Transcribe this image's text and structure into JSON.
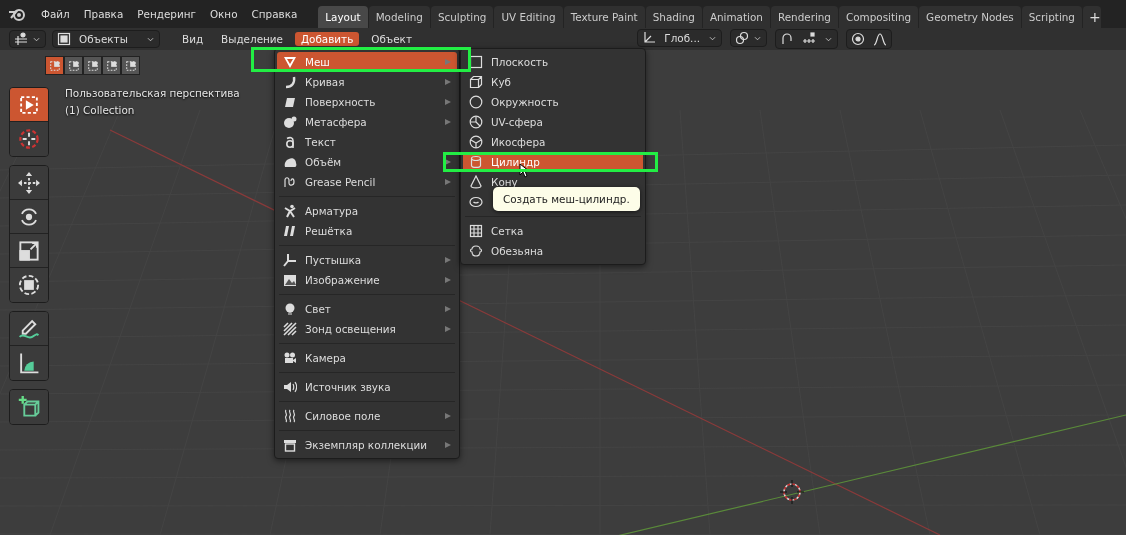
{
  "top_bar": {
    "menus": [
      "Файл",
      "Правка",
      "Рендеринг",
      "Окно",
      "Справка"
    ],
    "workspace_tabs": [
      {
        "label": "Layout",
        "selected": true
      },
      {
        "label": "Modeling",
        "selected": false
      },
      {
        "label": "Sculpting",
        "selected": false
      },
      {
        "label": "UV Editing",
        "selected": false
      },
      {
        "label": "Texture Paint",
        "selected": false
      },
      {
        "label": "Shading",
        "selected": false
      },
      {
        "label": "Animation",
        "selected": false
      },
      {
        "label": "Rendering",
        "selected": false
      },
      {
        "label": "Compositing",
        "selected": false
      },
      {
        "label": "Geometry Nodes",
        "selected": false
      },
      {
        "label": "Scripting",
        "selected": false
      }
    ],
    "add_tab_button": "+"
  },
  "header": {
    "mode_dropdown": "Объекты",
    "menus": [
      {
        "label": "Вид",
        "selected": false
      },
      {
        "label": "Выделение",
        "selected": false
      },
      {
        "label": "Добавить",
        "selected": true
      },
      {
        "label": "Объект",
        "selected": false
      }
    ],
    "orientation_dropdown": "Глоб..."
  },
  "toolbar": {
    "select_modes": [
      {
        "selected": true
      },
      {
        "selected": false
      },
      {
        "selected": false
      },
      {
        "selected": false
      },
      {
        "selected": false
      }
    ],
    "tools": [
      {
        "selected": true
      },
      {
        "selected": false
      },
      {
        "selected": false
      },
      {
        "selected": false
      },
      {
        "selected": false
      },
      {
        "selected": false
      },
      {
        "selected": false
      },
      {
        "selected": false
      },
      {
        "selected": false
      }
    ]
  },
  "viewport": {
    "view_name": "Пользовательская перспектива",
    "collection": "(1) Collection"
  },
  "add_menu": {
    "items": [
      {
        "kind": "item",
        "label": "Меш",
        "has_submenu": true,
        "selected": true
      },
      {
        "kind": "item",
        "label": "Кривая",
        "has_submenu": true,
        "selected": false
      },
      {
        "kind": "item",
        "label": "Поверхность",
        "has_submenu": true,
        "selected": false
      },
      {
        "kind": "item",
        "label": "Метасфера",
        "has_submenu": true,
        "selected": false
      },
      {
        "kind": "item",
        "label": "Текст",
        "has_submenu": false,
        "selected": false
      },
      {
        "kind": "item",
        "label": "Объём",
        "has_submenu": true,
        "selected": false
      },
      {
        "kind": "item",
        "label": "Grease Pencil",
        "has_submenu": true,
        "selected": false
      },
      {
        "kind": "separator"
      },
      {
        "kind": "item",
        "label": "Арматура",
        "has_submenu": false,
        "selected": false
      },
      {
        "kind": "item",
        "label": "Решётка",
        "has_submenu": false,
        "selected": false
      },
      {
        "kind": "separator"
      },
      {
        "kind": "item",
        "label": "Пустышка",
        "has_submenu": true,
        "selected": false
      },
      {
        "kind": "item",
        "label": "Изображение",
        "has_submenu": true,
        "selected": false
      },
      {
        "kind": "separator"
      },
      {
        "kind": "item",
        "label": "Свет",
        "has_submenu": true,
        "selected": false
      },
      {
        "kind": "item",
        "label": "Зонд освещения",
        "has_submenu": true,
        "selected": false
      },
      {
        "kind": "separator"
      },
      {
        "kind": "item",
        "label": "Камера",
        "has_submenu": false,
        "selected": false
      },
      {
        "kind": "separator"
      },
      {
        "kind": "item",
        "label": "Источник звука",
        "has_submenu": false,
        "selected": false
      },
      {
        "kind": "separator"
      },
      {
        "kind": "item",
        "label": "Силовое поле",
        "has_submenu": true,
        "selected": false
      },
      {
        "kind": "separator"
      },
      {
        "kind": "item",
        "label": "Экземпляр коллекции",
        "has_submenu": true,
        "selected": false
      }
    ]
  },
  "mesh_menu": {
    "items": [
      {
        "kind": "item",
        "label": "Плоскость",
        "selected": false
      },
      {
        "kind": "item",
        "label": "Куб",
        "selected": false
      },
      {
        "kind": "item",
        "label": "Окружность",
        "selected": false
      },
      {
        "kind": "item",
        "label": "UV-сфера",
        "selected": false
      },
      {
        "kind": "item",
        "label": "Икосфера",
        "selected": false
      },
      {
        "kind": "item",
        "label": "Цилиндр",
        "selected": true
      },
      {
        "kind": "item",
        "label": "Кону",
        "selected": false
      },
      {
        "kind": "item",
        "selected": false
      },
      {
        "kind": "separator"
      },
      {
        "kind": "item",
        "label": "Сетка",
        "selected": false
      },
      {
        "kind": "item",
        "label": "Обезьяна",
        "selected": false
      }
    ],
    "tooltip": "Создать меш-цилиндр."
  }
}
